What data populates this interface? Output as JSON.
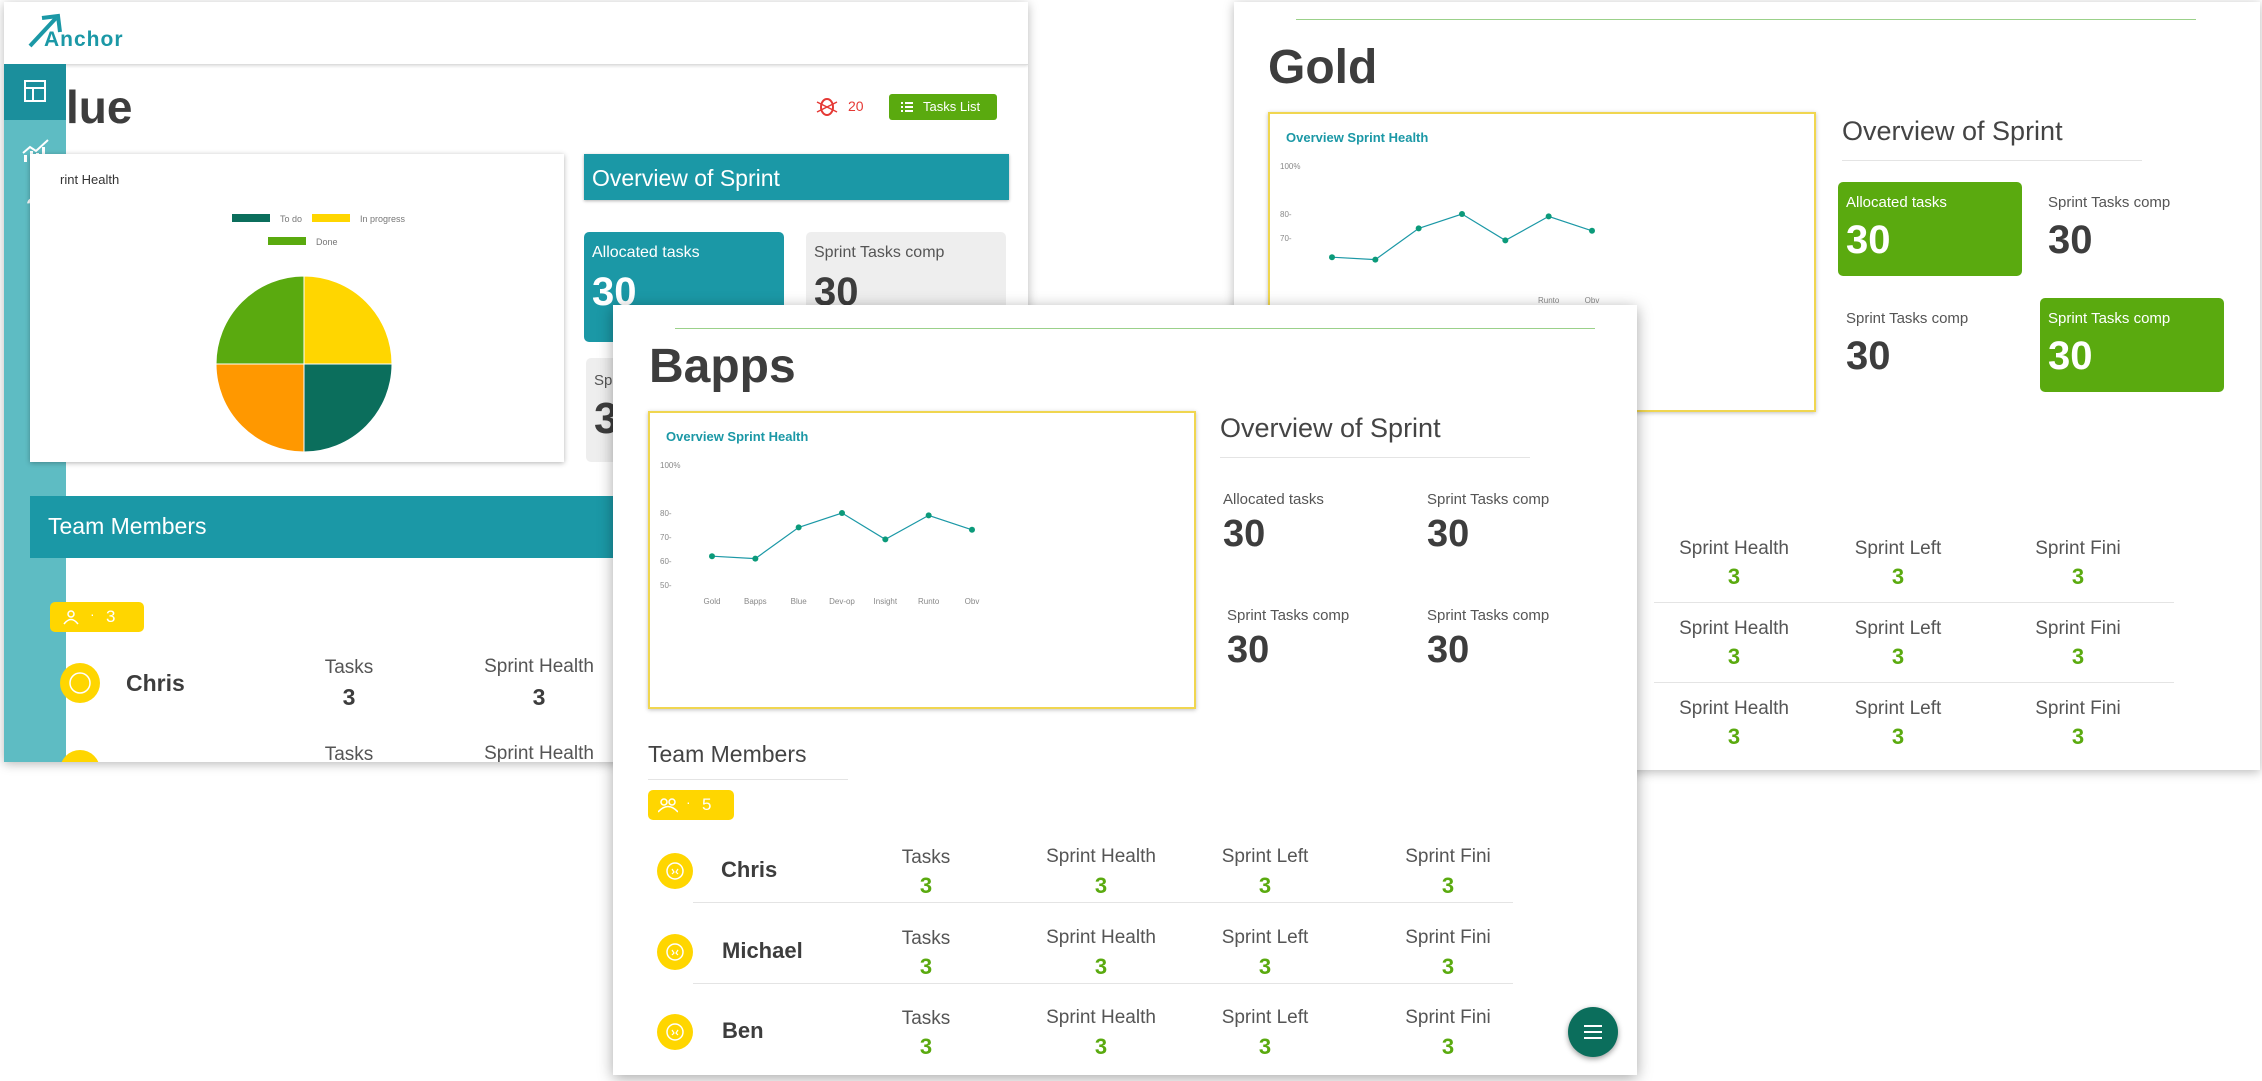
{
  "blue": {
    "brand": "Anchor",
    "title": "lue",
    "alert_count": "20",
    "tasks_list_label": "Tasks List",
    "chart_title": "rint Health",
    "legend": [
      "To do",
      "In progress",
      "Done"
    ],
    "overview_title": "Overview of Sprint",
    "tile1": {
      "label": "Allocated tasks",
      "value": "30"
    },
    "tile2": {
      "label": "Sprint Tasks comp",
      "value": "30"
    },
    "tile3_label": "Sp",
    "tile3_value": "3",
    "team_title": "Team Members",
    "team_count": "3",
    "member": {
      "name": "Chris",
      "tasks_label": "Tasks",
      "tasks": "3",
      "health_label": "Sprint Health",
      "health": "3"
    },
    "row2": {
      "tasks_label": "Tasks",
      "health_label": "Sprint Health"
    },
    "pie": [
      {
        "name": "In progress",
        "value": 25,
        "color": "#ffd600"
      },
      {
        "name": "To do",
        "value": 25,
        "color": "#0b6e5c"
      },
      {
        "name": "Orange",
        "value": 25,
        "color": "#ff9800"
      },
      {
        "name": "Done",
        "value": 25,
        "color": "#5aaa0f"
      }
    ]
  },
  "gold": {
    "title": "Gold",
    "chart_title": "Overview Sprint Health",
    "overview_title": "Overview of Sprint",
    "tiles": [
      {
        "label": "Allocated tasks",
        "value": "30"
      },
      {
        "label": "Sprint Tasks comp",
        "value": "30"
      },
      {
        "label": "Sprint Tasks comp",
        "value": "30"
      },
      {
        "label": "Sprint Tasks comp",
        "value": "30"
      }
    ],
    "rows": [
      {
        "health_label": "Sprint Health",
        "health": "3",
        "left_label": "Sprint Left",
        "left": "3",
        "fini_label": "Sprint Fini",
        "fini": "3"
      },
      {
        "health_label": "Sprint Health",
        "health": "3",
        "left_label": "Sprint Left",
        "left": "3",
        "fini_label": "Sprint Fini",
        "fini": "3"
      },
      {
        "health_label": "Sprint Health",
        "health": "3",
        "left_label": "Sprint Left",
        "left": "3",
        "fini_label": "Sprint Fini",
        "fini": "3"
      }
    ]
  },
  "bapps": {
    "title": "Bapps",
    "chart_title": "Overview Sprint Health",
    "overview_title": "Overview of Sprint",
    "stats": [
      {
        "label": "Allocated tasks",
        "value": "30"
      },
      {
        "label": "Sprint Tasks comp",
        "value": "30"
      },
      {
        "label": "Sprint Tasks comp",
        "value": "30"
      },
      {
        "label": "Sprint Tasks comp",
        "value": "30"
      }
    ],
    "team_title": "Team Members",
    "team_count": "5",
    "members": [
      {
        "name": "Chris",
        "tasks_label": "Tasks",
        "tasks": "3",
        "health_label": "Sprint Health",
        "health": "3",
        "left_label": "Sprint Left",
        "left": "3",
        "fini_label": "Sprint Fini",
        "fini": "3"
      },
      {
        "name": "Michael",
        "tasks_label": "Tasks",
        "tasks": "3",
        "health_label": "Sprint Health",
        "health": "3",
        "left_label": "Sprint Left",
        "left": "3",
        "fini_label": "Sprint Fini",
        "fini": "3"
      },
      {
        "name": "Ben",
        "tasks_label": "Tasks",
        "tasks": "3",
        "health_label": "Sprint Health",
        "health": "3",
        "left_label": "Sprint Left",
        "left": "3",
        "fini_label": "Sprint Fini",
        "fini": "3"
      }
    ]
  },
  "chart_data": [
    {
      "type": "pie",
      "title": "rint Health",
      "legend_entries": [
        "To do",
        "In progress",
        "Done"
      ],
      "slices": [
        {
          "label": "In progress",
          "value": 25,
          "color": "#ffd600"
        },
        {
          "label": "To do",
          "value": 25,
          "color": "#0b6e5c"
        },
        {
          "label": "",
          "value": 25,
          "color": "#ff9800"
        },
        {
          "label": "Done",
          "value": 25,
          "color": "#5aaa0f"
        }
      ]
    },
    {
      "type": "line",
      "title": "Overview Sprint Health",
      "categories": [
        "Gold",
        "Bapps",
        "Blue",
        "Dev-op",
        "Insight",
        "Runto",
        "Obv"
      ],
      "values": [
        62,
        61,
        74,
        80,
        69,
        79,
        73
      ],
      "yticks": [
        "50-",
        "60-",
        "70-",
        "80-",
        "100%"
      ],
      "ylim": [
        50,
        100
      ],
      "color": "#1b98a6"
    },
    {
      "type": "line",
      "title": "Overview Sprint Health",
      "categories": [
        "Gold",
        "Bapps",
        "Blue",
        "Dev-op",
        "Insight",
        "Runto",
        "Obv"
      ],
      "values": [
        62,
        61,
        74,
        80,
        69,
        79,
        73
      ],
      "yticks": [
        "70-",
        "80-",
        "100%"
      ],
      "visible_xticks": [
        "Runto",
        "Obv"
      ],
      "ylim": [
        50,
        100
      ],
      "color": "#1b98a6"
    }
  ]
}
